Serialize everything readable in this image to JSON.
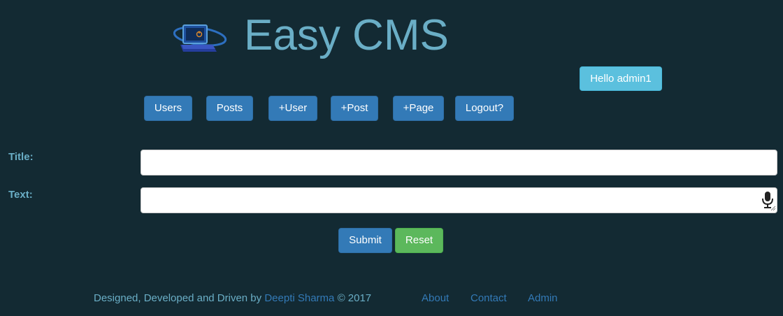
{
  "header": {
    "site_title": "Easy CMS",
    "logo_icon": "laptop-power-logo",
    "greeting": "Hello admin1"
  },
  "nav": {
    "users": "Users",
    "posts": "Posts",
    "add_user": "+User",
    "add_post": "+Post",
    "add_page": "+Page",
    "logout": "Logout?"
  },
  "form": {
    "title_label": "Title:",
    "title_value": "",
    "text_label": "Text:",
    "text_value": "",
    "submit_label": "Submit",
    "reset_label": "Reset"
  },
  "footer": {
    "credit_prefix": "Designed, Developed and Driven by",
    "author": "Deepti Sharma",
    "credit_suffix": "© 2017",
    "links": [
      "About",
      "Contact",
      "Admin"
    ]
  },
  "colors": {
    "background": "#132a33",
    "accent_text": "#6aaec6",
    "primary_button": "#337ab7",
    "info_button": "#5bc0de",
    "success_button": "#5cb85c"
  }
}
